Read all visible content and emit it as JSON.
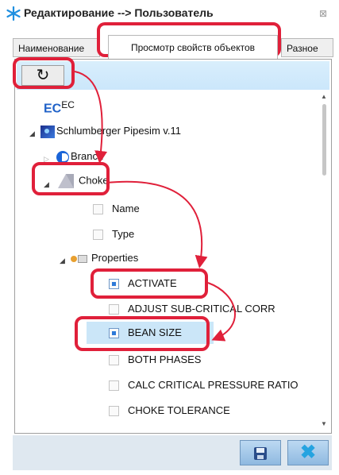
{
  "window": {
    "title": "Редактирование --> Пользователь",
    "close_glyph": "⊠"
  },
  "tabs": [
    {
      "label": "Наименование",
      "selected": false
    },
    {
      "label": "Просмотр свойств объектов",
      "selected": true
    },
    {
      "label": "Разное",
      "selected": false
    }
  ],
  "toolbar": {
    "refresh_glyph": "↻"
  },
  "tree": {
    "ec": {
      "icon_text": "EC",
      "label": "EC"
    },
    "pipesim": {
      "label": "Schlumberger Pipesim v.11"
    },
    "branch": {
      "label": "Branch"
    },
    "choke": {
      "label": "Choke"
    },
    "name": {
      "label": "Name",
      "checked": false
    },
    "type": {
      "label": "Type",
      "checked": false
    },
    "properties": {
      "label": "Properties"
    },
    "items": [
      {
        "label": "ACTIVATE",
        "checked": true
      },
      {
        "label": "ADJUST SUB-CRITICAL CORR",
        "checked": false
      },
      {
        "label": "BEAN SIZE",
        "checked": true
      },
      {
        "label": "BOTH PHASES",
        "checked": false
      },
      {
        "label": "CALC CRITICAL PRESSURE RATIO",
        "checked": false
      },
      {
        "label": "CHOKE TOLERANCE",
        "checked": false
      }
    ]
  },
  "footer": {
    "save_glyph": "💾",
    "cancel_glyph": "✖"
  },
  "annotation_color": "#e0203a",
  "accent_color": "#2d7ad8"
}
